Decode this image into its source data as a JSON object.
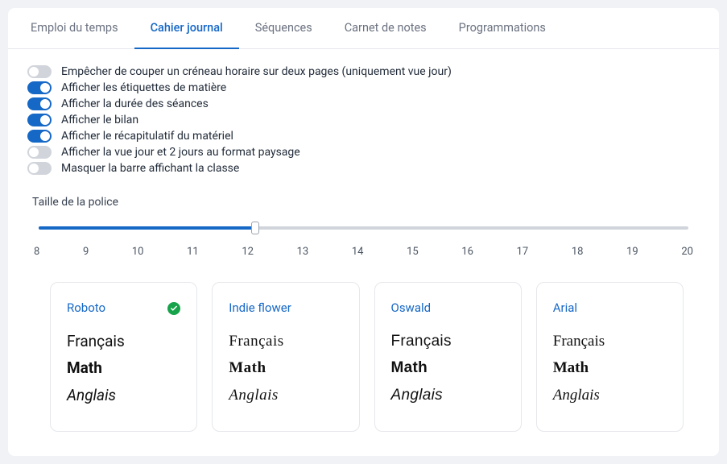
{
  "tabs": [
    {
      "label": "Emploi du temps",
      "active": false
    },
    {
      "label": "Cahier journal",
      "active": true
    },
    {
      "label": "Séquences",
      "active": false
    },
    {
      "label": "Carnet de notes",
      "active": false
    },
    {
      "label": "Programmations",
      "active": false
    }
  ],
  "toggles": [
    {
      "label": "Empêcher de couper un créneau horaire sur deux pages (uniquement vue jour)",
      "on": false
    },
    {
      "label": "Afficher les étiquettes de matière",
      "on": true
    },
    {
      "label": "Afficher la durée des séances",
      "on": true
    },
    {
      "label": "Afficher le bilan",
      "on": true
    },
    {
      "label": "Afficher le récapitulatif du matériel",
      "on": true
    },
    {
      "label": "Afficher la vue jour et 2 jours au format paysage",
      "on": false
    },
    {
      "label": "Masquer la barre affichant la classe",
      "on": false
    }
  ],
  "slider": {
    "title": "Taille de la police",
    "min": 8,
    "max": 20,
    "value": 12,
    "ticks": [
      "8",
      "9",
      "10",
      "11",
      "12",
      "13",
      "14",
      "15",
      "16",
      "17",
      "18",
      "19",
      "20"
    ]
  },
  "fonts": [
    {
      "name": "Roboto",
      "class": "f-roboto",
      "selected": true,
      "samples": [
        "Français",
        "Math",
        "Anglais"
      ]
    },
    {
      "name": "Indie flower",
      "class": "f-indie",
      "selected": false,
      "samples": [
        "Français",
        "Math",
        "Anglais"
      ]
    },
    {
      "name": "Oswald",
      "class": "f-oswald",
      "selected": false,
      "samples": [
        "Français",
        "Math",
        "Anglais"
      ]
    },
    {
      "name": "Arial",
      "class": "f-arial",
      "selected": false,
      "samples": [
        "Français",
        "Math",
        "Anglais"
      ]
    }
  ]
}
